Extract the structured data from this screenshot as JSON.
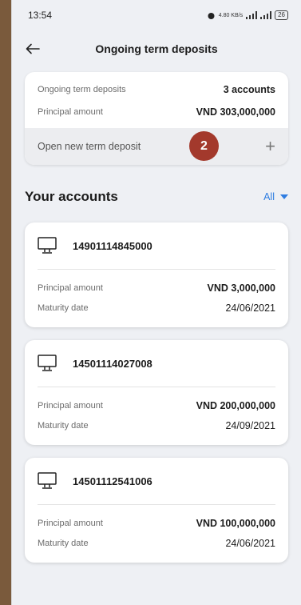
{
  "status": {
    "time": "13:54",
    "network": "4.80 KB/s",
    "battery": "26"
  },
  "header": {
    "title": "Ongoing term deposits"
  },
  "summary": {
    "ongoing_label": "Ongoing term deposits",
    "ongoing_value": "3 accounts",
    "principal_label": "Principal amount",
    "principal_value": "VND 303,000,000",
    "open_label": "Open new term deposit",
    "plus": "+",
    "step_badge": "2"
  },
  "accounts_section": {
    "title": "Your accounts",
    "filter": "All"
  },
  "accounts": [
    {
      "number": "14901114845000",
      "principal_label": "Principal amount",
      "principal": "VND 3,000,000",
      "maturity_label": "Maturity date",
      "maturity": "24/06/2021"
    },
    {
      "number": "14501114027008",
      "principal_label": "Principal amount",
      "principal": "VND 200,000,000",
      "maturity_label": "Maturity date",
      "maturity": "24/09/2021"
    },
    {
      "number": "14501112541006",
      "principal_label": "Principal amount",
      "principal": "VND 100,000,000",
      "maturity_label": "Maturity date",
      "maturity": "24/06/2021"
    }
  ],
  "icons": {
    "back": "arrow-left-icon",
    "account": "monitor-icon",
    "add": "plus-icon",
    "filter": "caret-down-icon"
  },
  "colors": {
    "accent": "#2f7de1",
    "badge": "#a3392c",
    "background": "#eef0f4"
  }
}
